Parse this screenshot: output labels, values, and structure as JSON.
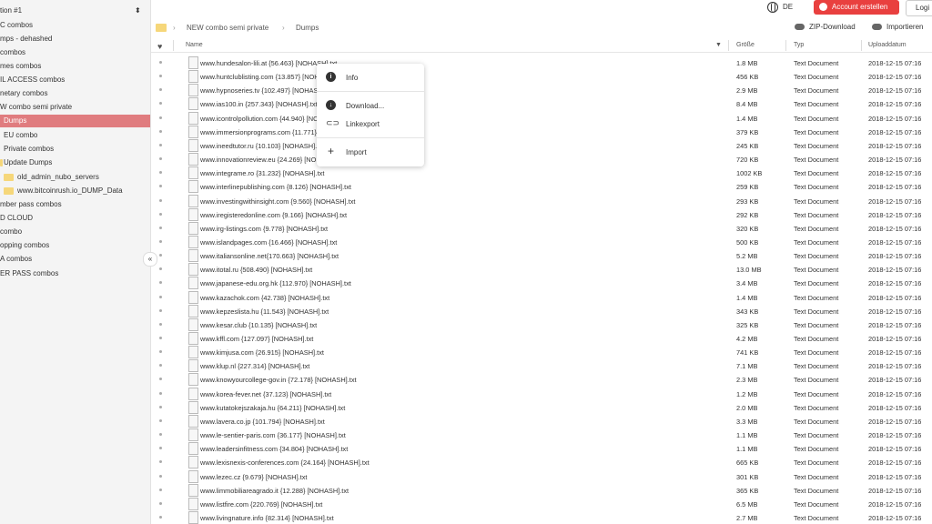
{
  "sidebar": {
    "items": [
      {
        "label": "tion #1"
      },
      {
        "label": "C combos"
      },
      {
        "label": "mps - dehashed"
      },
      {
        "label": "combos"
      },
      {
        "label": "mes combos"
      },
      {
        "label": "IL ACCESS combos"
      },
      {
        "label": "netary combos"
      },
      {
        "label": "W combo semi private"
      },
      {
        "label": "Dumps"
      },
      {
        "label": "EU combo"
      },
      {
        "label": "Private combos"
      },
      {
        "label": "Update Dumps"
      },
      {
        "label": "old_admin_nubo_servers"
      },
      {
        "label": "www.bitcoinrush.io_DUMP_Data"
      },
      {
        "label": "mber pass combos"
      },
      {
        "label": "D CLOUD"
      },
      {
        "label": "combo"
      },
      {
        "label": "opping combos"
      },
      {
        "label": "A combos"
      },
      {
        "label": "ER PASS combos"
      }
    ],
    "caret": "⬍",
    "collapse": "«"
  },
  "topbar": {
    "lang": "DE",
    "account": "Account erstellen",
    "login": "Logi"
  },
  "breadcrumb": {
    "parent": "NEW combo semi private",
    "current": "Dumps",
    "sep": "›"
  },
  "actions": {
    "zip": "ZIP-Download",
    "import": "Importieren"
  },
  "columns": {
    "fav": "♥",
    "name": "Name",
    "size": "Größe",
    "type": "Typ",
    "date": "Uploaddatum"
  },
  "files": [
    {
      "name": "www.hundesalon-lili.at {56.463} [NOHASH].txt",
      "size": "1.8 MB",
      "type": "Text Document",
      "date": "2018-12-15 07:16"
    },
    {
      "name": "www.huntclublisting.com {13.857} [NOHASH].txt",
      "size": "456 KB",
      "type": "Text Document",
      "date": "2018-12-15 07:16"
    },
    {
      "name": "www.hypnoseries.tv {102.497} [NOHASH].txt",
      "size": "2.9 MB",
      "type": "Text Document",
      "date": "2018-12-15 07:16"
    },
    {
      "name": "www.ias100.in {257.343} [NOHASH].txt",
      "size": "8.4 MB",
      "type": "Text Document",
      "date": "2018-12-15 07:16"
    },
    {
      "name": "www.icontrolpollution.com {44.940} [NOHASH].txt",
      "size": "1.4 MB",
      "type": "Text Document",
      "date": "2018-12-15 07:16"
    },
    {
      "name": "www.immersionprograms.com {11.771} [NOHASH].txt",
      "size": "379 KB",
      "type": "Text Document",
      "date": "2018-12-15 07:16"
    },
    {
      "name": "www.ineedtutor.ru {10.103} [NOHASH].txt",
      "size": "245 KB",
      "type": "Text Document",
      "date": "2018-12-15 07:16"
    },
    {
      "name": "www.innovationreview.eu {24.269} [NOHASH].txt",
      "size": "720 KB",
      "type": "Text Document",
      "date": "2018-12-15 07:16"
    },
    {
      "name": "www.integrame.ro {31.232} [NOHASH].txt",
      "size": "1002 KB",
      "type": "Text Document",
      "date": "2018-12-15 07:16"
    },
    {
      "name": "www.interlinepublishing.com {8.126} [NOHASH].txt",
      "size": "259 KB",
      "type": "Text Document",
      "date": "2018-12-15 07:16"
    },
    {
      "name": "www.investingwithinsight.com {9.560} [NOHASH].txt",
      "size": "293 KB",
      "type": "Text Document",
      "date": "2018-12-15 07:16"
    },
    {
      "name": "www.iregisteredonline.com {9.166} [NOHASH].txt",
      "size": "292 KB",
      "type": "Text Document",
      "date": "2018-12-15 07:16"
    },
    {
      "name": "www.irg-listings.com {9.778} [NOHASH].txt",
      "size": "320 KB",
      "type": "Text Document",
      "date": "2018-12-15 07:16"
    },
    {
      "name": "www.islandpages.com {16.466} [NOHASH].txt",
      "size": "500 KB",
      "type": "Text Document",
      "date": "2018-12-15 07:16"
    },
    {
      "name": "www.italiansonline.net{170.663} [NOHASH].txt",
      "size": "5.2 MB",
      "type": "Text Document",
      "date": "2018-12-15 07:16"
    },
    {
      "name": "www.itotal.ru {508.490} [NOHASH].txt",
      "size": "13.0 MB",
      "type": "Text Document",
      "date": "2018-12-15 07:16"
    },
    {
      "name": "www.japanese-edu.org.hk {112.970} [NOHASH].txt",
      "size": "3.4 MB",
      "type": "Text Document",
      "date": "2018-12-15 07:16"
    },
    {
      "name": "www.kazachok.com {42.738} [NOHASH].txt",
      "size": "1.4 MB",
      "type": "Text Document",
      "date": "2018-12-15 07:16"
    },
    {
      "name": "www.kepzeslista.hu {11.543} [NOHASH].txt",
      "size": "343 KB",
      "type": "Text Document",
      "date": "2018-12-15 07:16"
    },
    {
      "name": "www.kesar.club {10.135} [NOHASH].txt",
      "size": "325 KB",
      "type": "Text Document",
      "date": "2018-12-15 07:16"
    },
    {
      "name": "www.kffl.com {127.097} [NOHASH].txt",
      "size": "4.2 MB",
      "type": "Text Document",
      "date": "2018-12-15 07:16"
    },
    {
      "name": "www.kimjusa.com {26.915} [NOHASH].txt",
      "size": "741 KB",
      "type": "Text Document",
      "date": "2018-12-15 07:16"
    },
    {
      "name": "www.klup.nl {227.314} [NOHASH].txt",
      "size": "7.1 MB",
      "type": "Text Document",
      "date": "2018-12-15 07:16"
    },
    {
      "name": "www.knowyourcollege-gov.in {72.178} [NOHASH].txt",
      "size": "2.3 MB",
      "type": "Text Document",
      "date": "2018-12-15 07:16"
    },
    {
      "name": "www.korea-fever.net {37.123} [NOHASH].txt",
      "size": "1.2 MB",
      "type": "Text Document",
      "date": "2018-12-15 07:16"
    },
    {
      "name": "www.kutatokejszakaja.hu {64.211} [NOHASH].txt",
      "size": "2.0 MB",
      "type": "Text Document",
      "date": "2018-12-15 07:16"
    },
    {
      "name": "www.lavera.co.jp {101.794} [NOHASH].txt",
      "size": "3.3 MB",
      "type": "Text Document",
      "date": "2018-12-15 07:16"
    },
    {
      "name": "www.le-sentier-paris.com {36.177} [NOHASH].txt",
      "size": "1.1 MB",
      "type": "Text Document",
      "date": "2018-12-15 07:16"
    },
    {
      "name": "www.leadersinfitness.com {34.804} [NOHASH].txt",
      "size": "1.1 MB",
      "type": "Text Document",
      "date": "2018-12-15 07:16"
    },
    {
      "name": "www.lexisnexis-conferences.com {24.164} [NOHASH].txt",
      "size": "665 KB",
      "type": "Text Document",
      "date": "2018-12-15 07:16"
    },
    {
      "name": "www.lezec.cz {9.679} [NOHASH].txt",
      "size": "301 KB",
      "type": "Text Document",
      "date": "2018-12-15 07:16"
    },
    {
      "name": "www.limmobiliareagrado.it {12.288} [NOHASH].txt",
      "size": "365 KB",
      "type": "Text Document",
      "date": "2018-12-15 07:16"
    },
    {
      "name": "www.listfire.com {220.769} [NOHASH].txt",
      "size": "6.5 MB",
      "type": "Text Document",
      "date": "2018-12-15 07:16"
    },
    {
      "name": "www.livingnature.info {82.314} [NOHASH].txt",
      "size": "2.7 MB",
      "type": "Text Document",
      "date": "2018-12-15 07:16"
    }
  ],
  "context_menu": {
    "items": [
      {
        "label": "Info",
        "icon": "info-icon"
      },
      {
        "label": "Download...",
        "icon": "download-icon"
      },
      {
        "label": "Linkexport",
        "icon": "link-icon"
      },
      {
        "label": "Import",
        "icon": "plus-icon"
      }
    ]
  }
}
